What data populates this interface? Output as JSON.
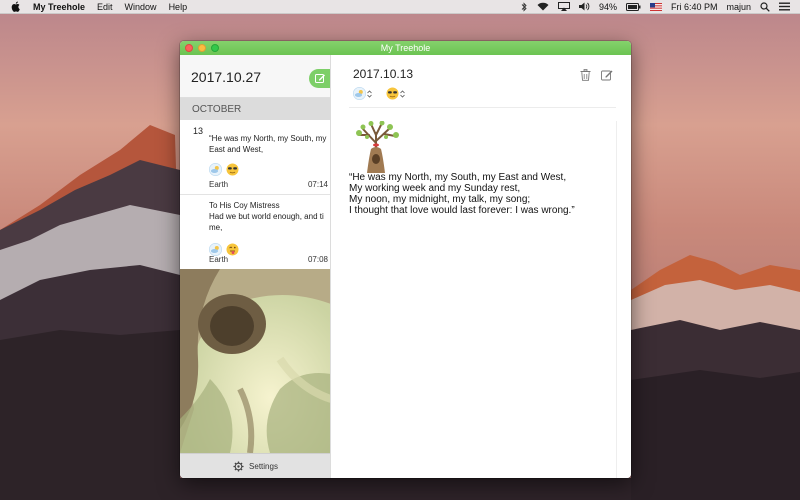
{
  "menubar": {
    "app_name": "My Treehole",
    "menus": [
      "Edit",
      "Window",
      "Help"
    ],
    "battery": "94%",
    "clock": "Fri 6:40 PM",
    "user": "majun",
    "icons": [
      "bluetooth-icon",
      "wifi-icon",
      "airplay-icon",
      "volume-icon",
      "battery-icon",
      "flag-icon",
      "search-icon",
      "list-icon"
    ]
  },
  "window": {
    "title": "My Treehole"
  },
  "sidebar": {
    "header_date": "2017.10.27",
    "month": "OCTOBER",
    "entries": [
      {
        "day": "13",
        "text": "“He was my North, my South, my East and West,",
        "location": "Earth",
        "time": "07:14",
        "weather_icon": "cloud-sun-icon",
        "mood_icon": "sunglasses-emoji"
      },
      {
        "day": "",
        "text": "To His Coy Mistress\nHad we but world enough, and time,",
        "location": "Earth",
        "time": "07:08",
        "weather_icon": "cloud-sun-icon",
        "mood_icon": "tongue-emoji"
      }
    ],
    "settings_label": "Settings"
  },
  "detail": {
    "date": "2017.10.13",
    "body": "“He was my North, my South, my East and West,\nMy working week and my Sunday rest,\nMy noon, my midnight, my talk, my song;\nI thought that love would last forever: I was wrong.”"
  },
  "colors": {
    "accent": "#7dcf68",
    "titlebar": "#6cc452"
  }
}
